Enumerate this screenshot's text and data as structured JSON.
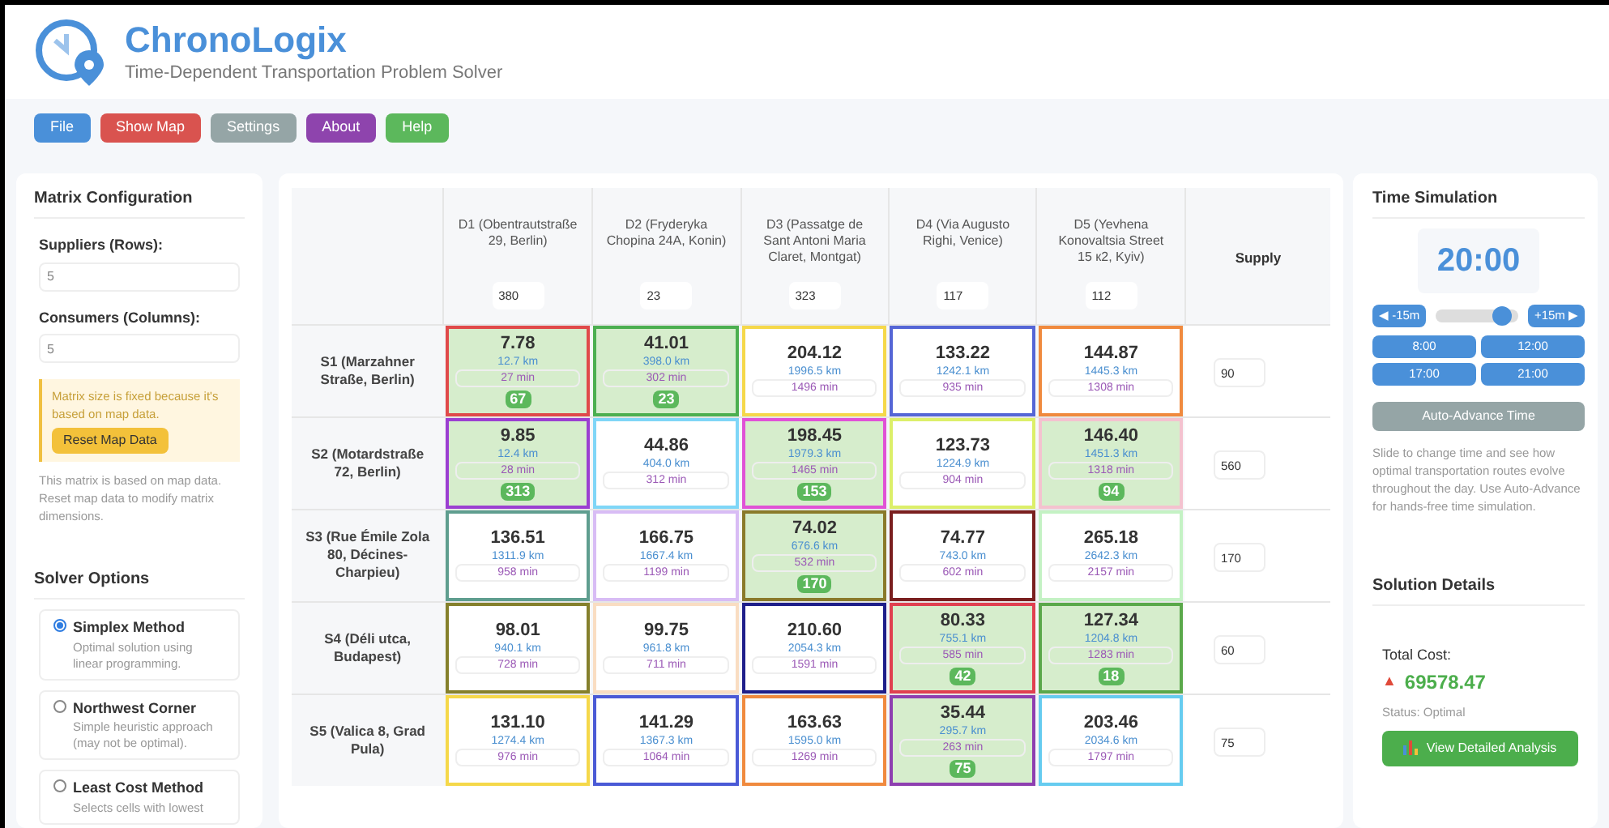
{
  "app": {
    "title": "ChronoLogix",
    "subtitle": "Time-Dependent Transportation Problem Solver"
  },
  "toolbar": [
    {
      "label": "File",
      "color": "#4a90d9"
    },
    {
      "label": "Show Map",
      "color": "#d9534f"
    },
    {
      "label": "Settings",
      "color": "#95a5a6"
    },
    {
      "label": "About",
      "color": "#8e44ad"
    },
    {
      "label": "Help",
      "color": "#5cb85c"
    }
  ],
  "matrix_config": {
    "title": "Matrix Configuration",
    "fields": [
      {
        "label": "Suppliers (Rows):",
        "value": "5"
      },
      {
        "label": "Consumers (Columns):",
        "value": "5"
      }
    ],
    "warning": "Matrix size is fixed because it's based on map data.",
    "reset_button": "Reset Map Data",
    "note": "This matrix is based on map data. Reset map data to modify matrix dimensions."
  },
  "solver_options": {
    "title": "Solver Options",
    "options": [
      {
        "name": "Simplex Method",
        "description": "Optimal solution using linear programming.",
        "selected": true
      },
      {
        "name": "Northwest Corner",
        "description": "Simple heuristic approach (may not be optimal).",
        "selected": false
      },
      {
        "name": "Least Cost Method",
        "description": "Selects cells with lowest",
        "selected": false
      }
    ]
  },
  "table": {
    "columns": [
      {
        "label": "D1 (Obentrautstraße 29, Berlin)",
        "demand": "380"
      },
      {
        "label": "D2 (Fryderyka Chopina 24A, Konin)",
        "demand": "23"
      },
      {
        "label": "D3 (Passatge de Sant Antoni Maria Claret, Montgat)",
        "demand": "323"
      },
      {
        "label": "D4 (Via Augusto Righi, Venice)",
        "demand": "117"
      },
      {
        "label": "D5 (Yevhena Konovaltsia Street 15 к2, Kyiv)",
        "demand": "112"
      }
    ],
    "supply_heading": "Supply",
    "rows": [
      {
        "label": "S1 (Marzahner Straße, Berlin)",
        "supply": "90",
        "cells": [
          {
            "cost": "7.78",
            "distance": "12.7 km",
            "time": "27 min",
            "allocation": "67",
            "color": "#e04a4a"
          },
          {
            "cost": "41.01",
            "distance": "398.0 km",
            "time": "302 min",
            "allocation": "23",
            "color": "#4caf50"
          },
          {
            "cost": "204.12",
            "distance": "1996.5 km",
            "time": "1496 min",
            "color": "#f5d84a"
          },
          {
            "cost": "133.22",
            "distance": "1242.1 km",
            "time": "935 min",
            "color": "#5566d6"
          },
          {
            "cost": "144.87",
            "distance": "1445.3 km",
            "time": "1308 min",
            "color": "#f08a3e"
          }
        ]
      },
      {
        "label": "S2 (Motardstraße 72, Berlin)",
        "supply": "560",
        "cells": [
          {
            "cost": "9.85",
            "distance": "12.4 km",
            "time": "28 min",
            "allocation": "313",
            "color": "#9b3fd1"
          },
          {
            "cost": "44.86",
            "distance": "404.0 km",
            "time": "312 min",
            "color": "#7fd6f7"
          },
          {
            "cost": "198.45",
            "distance": "1979.3 km",
            "time": "1465 min",
            "allocation": "153",
            "color": "#e052d6"
          },
          {
            "cost": "123.73",
            "distance": "1224.9 km",
            "time": "904 min",
            "color": "#dcef6a"
          },
          {
            "cost": "146.40",
            "distance": "1451.3 km",
            "time": "1318 min",
            "allocation": "94",
            "color": "#f4c2cf"
          }
        ]
      },
      {
        "label": "S3 (Rue Émile Zola 80, Décines-Charpieu)",
        "supply": "170",
        "cells": [
          {
            "cost": "136.51",
            "distance": "1311.9 km",
            "time": "958 min",
            "color": "#5f9e8f"
          },
          {
            "cost": "166.75",
            "distance": "1667.4 km",
            "time": "1199 min",
            "color": "#d8bcf5"
          },
          {
            "cost": "74.02",
            "distance": "676.6 km",
            "time": "532 min",
            "allocation": "170",
            "color": "#8a7a2a"
          },
          {
            "cost": "74.77",
            "distance": "743.0 km",
            "time": "602 min",
            "color": "#7a1f1f"
          },
          {
            "cost": "265.18",
            "distance": "2642.3 km",
            "time": "2157 min",
            "color": "#c4f2c4"
          }
        ]
      },
      {
        "label": "S4 (Déli utca, Budapest)",
        "supply": "60",
        "cells": [
          {
            "cost": "98.01",
            "distance": "940.1 km",
            "time": "728 min",
            "color": "#85802c"
          },
          {
            "cost": "99.75",
            "distance": "961.8 km",
            "time": "711 min",
            "color": "#f9ddc2"
          },
          {
            "cost": "210.60",
            "distance": "2054.3 km",
            "time": "1591 min",
            "color": "#1f1f8a"
          },
          {
            "cost": "80.33",
            "distance": "755.1 km",
            "time": "585 min",
            "allocation": "42",
            "color": "#e04050"
          },
          {
            "cost": "127.34",
            "distance": "1204.8 km",
            "time": "1283 min",
            "allocation": "18",
            "color": "#5aa84a"
          }
        ]
      },
      {
        "label": "S5 (Valica 8, Grad Pula)",
        "supply": "75",
        "cells": [
          {
            "cost": "131.10",
            "distance": "1274.4 km",
            "time": "976 min",
            "color": "#f5d84a"
          },
          {
            "cost": "141.29",
            "distance": "1367.3 km",
            "time": "1064 min",
            "color": "#4a5ad6"
          },
          {
            "cost": "163.63",
            "distance": "1595.0 km",
            "time": "1269 min",
            "color": "#f08a3e"
          },
          {
            "cost": "35.44",
            "distance": "295.7 km",
            "time": "263 min",
            "allocation": "75",
            "color": "#8e3fb0"
          },
          {
            "cost": "203.46",
            "distance": "2034.6 km",
            "time": "1797 min",
            "color": "#66ccf0"
          }
        ]
      }
    ]
  },
  "time_simulation": {
    "title": "Time Simulation",
    "time": "20:00",
    "back_button": "◀ -15m",
    "forward_button": "+15m ▶",
    "slider": {
      "level": 0.8
    },
    "presets": [
      "8:00",
      "12:00",
      "17:00",
      "21:00"
    ],
    "auto_button": "Auto-Advance Time",
    "note": "Slide to change time and see how optimal transportation routes evolve throughout the day. Use Auto-Advance for hands-free time simulation."
  },
  "solution": {
    "title": "Solution Details",
    "cost_label": "Total Cost:",
    "trend": "▲",
    "total_cost": "69578.47",
    "status": "Status: Optimal",
    "analysis_button": "View Detailed Analysis"
  }
}
